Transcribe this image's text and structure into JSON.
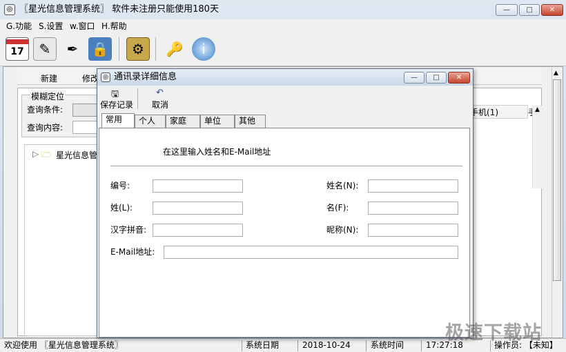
{
  "app": {
    "title": "〖星光信息管理系统〗 软件未注册只能使用180天",
    "controls": {
      "minimize": "—",
      "maximize": "□",
      "close": "✕"
    }
  },
  "menu": [
    {
      "label": "G.功能"
    },
    {
      "label": "S.设置"
    },
    {
      "label": "w.窗口"
    },
    {
      "label": "H.帮助"
    }
  ],
  "toolbar": {
    "icons": [
      "calendar-icon",
      "notepad-icon",
      "pen-tool-icon",
      "lock-icon",
      "settings-icon",
      "keys-icon",
      "info-globe-icon"
    ],
    "calendar_day": "17"
  },
  "background_window": {
    "new_label": "新建",
    "edit_label_partial": "修改",
    "fuzzy_group": "模糊定位",
    "query_condition": "查询条件:",
    "query_content": "查询内容:",
    "tree_root": "星光信息管理",
    "column_mobile": "手机(1)",
    "column_trunc": "手"
  },
  "dialog": {
    "title": "通讯录详细信息",
    "save_label": "保存记录",
    "cancel_label": "取消",
    "tabs": [
      "常用",
      "个人",
      "家庭",
      "单位",
      "其他"
    ],
    "active_tab": "常用",
    "hint": "在这里输入姓名和E-Mail地址",
    "fields": {
      "number": {
        "label": "编号:",
        "value": ""
      },
      "fullname": {
        "label": "姓名(N):",
        "value": ""
      },
      "surname": {
        "label": "姓(L):",
        "value": ""
      },
      "given": {
        "label": "名(F):",
        "value": ""
      },
      "pinyin": {
        "label": "汉字拼音:",
        "value": ""
      },
      "nickname": {
        "label": "昵称(N):",
        "value": ""
      },
      "email": {
        "label": "E-Mail地址:",
        "value": ""
      }
    }
  },
  "status": {
    "welcome": "欢迎使用 〖星光信息管理系统〗",
    "date_label": "系统日期",
    "date_value": "2018-10-24",
    "time_label": "系统时间",
    "time_value": "17:27:18",
    "operator": "操作员: 【未知】"
  },
  "watermark": "极速下载站"
}
